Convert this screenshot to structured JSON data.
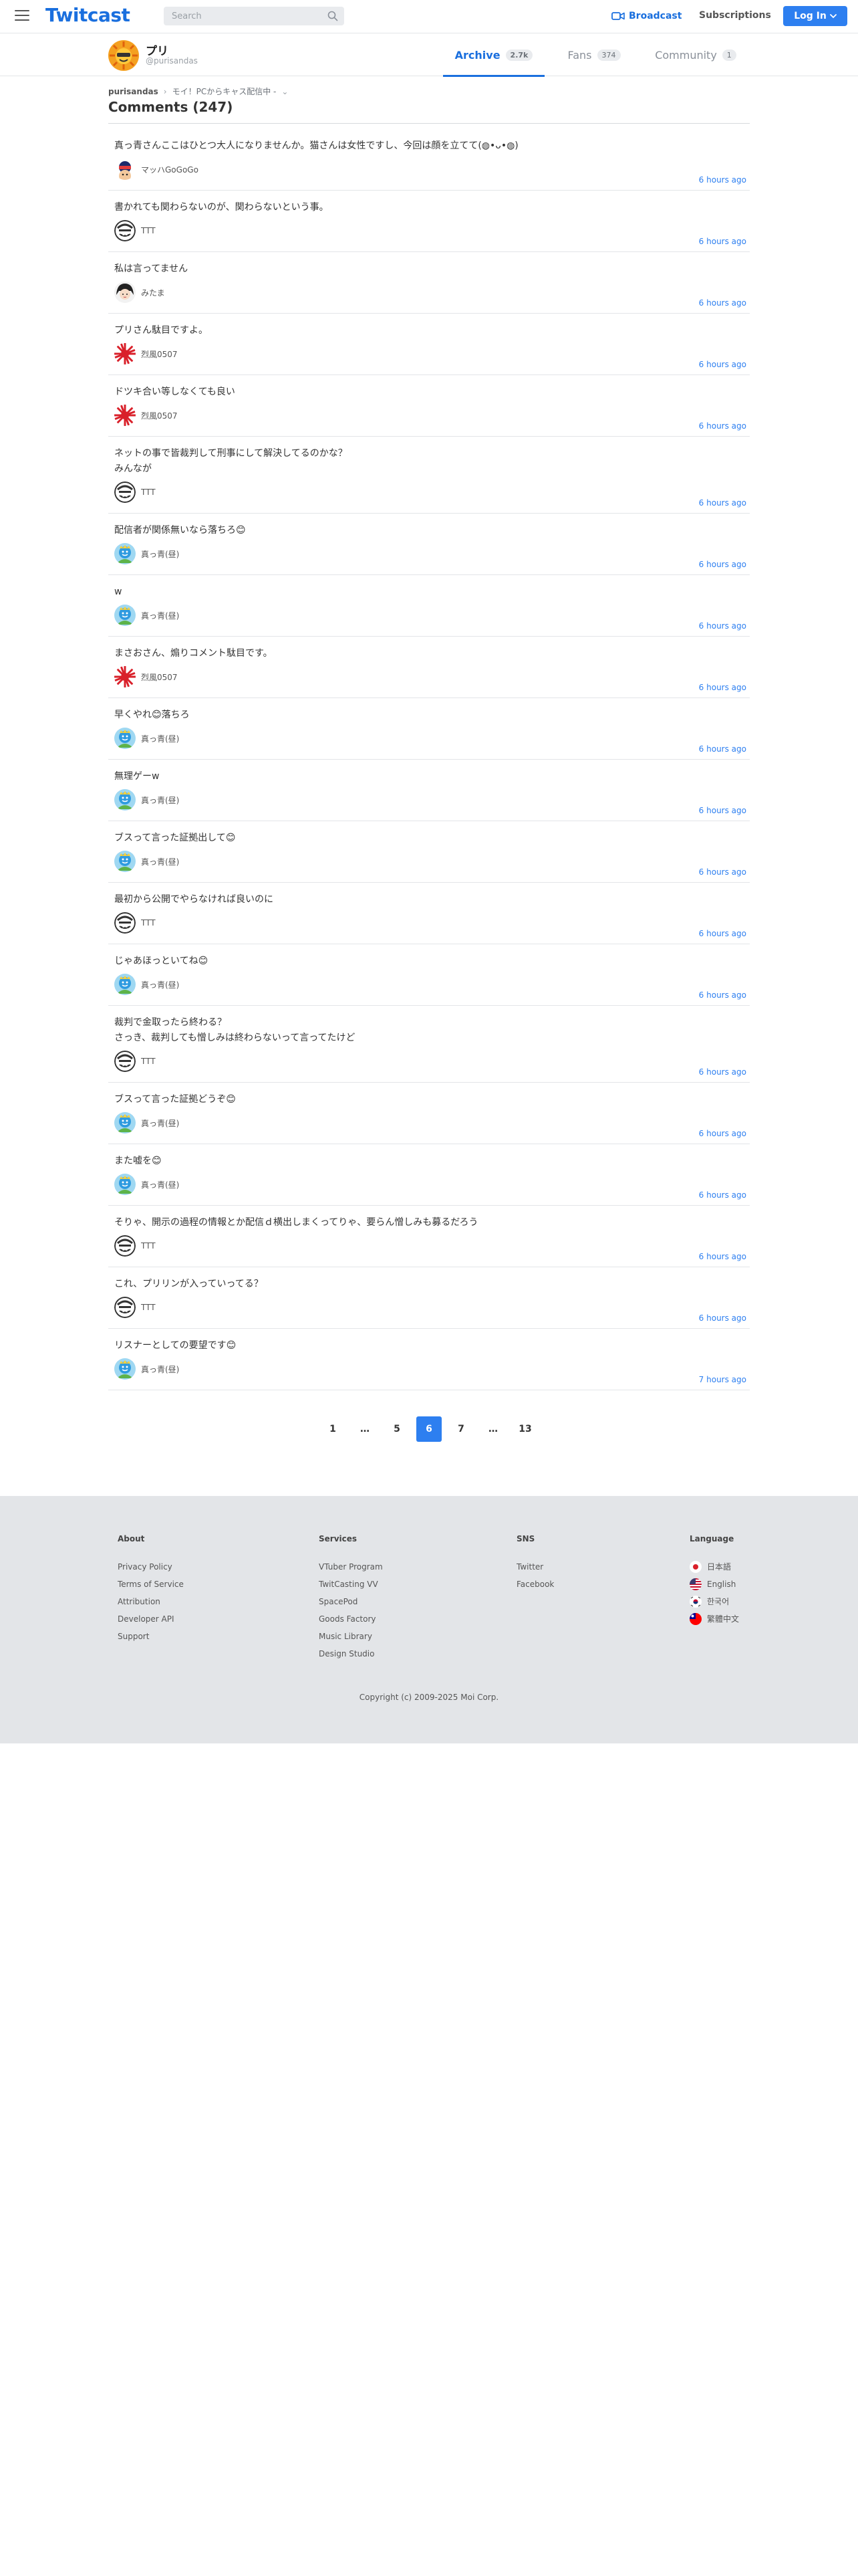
{
  "header": {
    "logo": "Twitcast",
    "search_placeholder": "Search",
    "broadcast_label": "Broadcast",
    "subscriptions_label": "Subscriptions",
    "login_label": "Log In"
  },
  "user": {
    "name": "プリ",
    "handle": "@purisandas"
  },
  "tabs": [
    {
      "label": "Archive",
      "count": "2.7k"
    },
    {
      "label": "Fans",
      "count": "374"
    },
    {
      "label": "Community",
      "count": "1"
    }
  ],
  "breadcrumb": {
    "user": "purisandas",
    "movie": "モイ！PCからキャス配信中 -"
  },
  "page_title": "Comments (247)",
  "comments": [
    {
      "text": "真っ青さんここはひとつ大人になりませんか。猫さんは女性ですし、今回は顔を立てて(◍•ᴗ•◍)",
      "user": "マッハGoGoGo",
      "time": "6 hours ago",
      "avatar": "mach"
    },
    {
      "text": "書かれても関わらないのが、関わらないという事。",
      "user": "TTT",
      "time": "6 hours ago",
      "avatar": "ttt"
    },
    {
      "text": "私は言ってません",
      "user": "みたま",
      "time": "6 hours ago",
      "avatar": "mitama"
    },
    {
      "text": "プリさん駄目ですよ。",
      "user": "烈風0507",
      "time": "6 hours ago",
      "avatar": "reppu"
    },
    {
      "text": "ドツキ合い等しなくても良い",
      "user": "烈風0507",
      "time": "6 hours ago",
      "avatar": "reppu"
    },
    {
      "text": "ネットの事で皆裁判して刑事にして解決してるのかな？\nみんなが",
      "user": "TTT",
      "time": "6 hours ago",
      "avatar": "ttt"
    },
    {
      "text": "配信者が関係無いなら落ちろ😊",
      "user": "真っ青(昼)",
      "time": "6 hours ago",
      "avatar": "massao"
    },
    {
      "text": "w",
      "user": "真っ青(昼)",
      "time": "6 hours ago",
      "avatar": "massao"
    },
    {
      "text": "まさおさん、煽りコメント駄目です。",
      "user": "烈風0507",
      "time": "6 hours ago",
      "avatar": "reppu"
    },
    {
      "text": "早くやれ😊落ちろ",
      "user": "真っ青(昼)",
      "time": "6 hours ago",
      "avatar": "massao"
    },
    {
      "text": "無理ゲーw",
      "user": "真っ青(昼)",
      "time": "6 hours ago",
      "avatar": "massao"
    },
    {
      "text": "ブスって言った証拠出して😊",
      "user": "真っ青(昼)",
      "time": "6 hours ago",
      "avatar": "massao"
    },
    {
      "text": "最初から公開でやらなければ良いのに",
      "user": "TTT",
      "time": "6 hours ago",
      "avatar": "ttt"
    },
    {
      "text": "じゃあほっといてね😊",
      "user": "真っ青(昼)",
      "time": "6 hours ago",
      "avatar": "massao"
    },
    {
      "text": "裁判で金取ったら終わる？\nさっき、裁判しても憎しみは終わらないって言ってたけど",
      "user": "TTT",
      "time": "6 hours ago",
      "avatar": "ttt"
    },
    {
      "text": "ブスって言った証拠どうぞ😊",
      "user": "真っ青(昼)",
      "time": "6 hours ago",
      "avatar": "massao"
    },
    {
      "text": "また嘘を😊",
      "user": "真っ青(昼)",
      "time": "6 hours ago",
      "avatar": "massao"
    },
    {
      "text": "そりゃ、開示の過程の情報とか配信ｄ横出しまくってりゃ、要らん憎しみも募るだろう",
      "user": "TTT",
      "time": "6 hours ago",
      "avatar": "ttt"
    },
    {
      "text": "これ、プリリンが入っていってる？",
      "user": "TTT",
      "time": "6 hours ago",
      "avatar": "ttt"
    },
    {
      "text": "リスナーとしての要望です😊",
      "user": "真っ青(昼)",
      "time": "7 hours ago",
      "avatar": "massao"
    }
  ],
  "pagination": [
    "1",
    "…",
    "5",
    "6",
    "7",
    "…",
    "13"
  ],
  "pagination_current": "6",
  "footer": {
    "about": {
      "title": "About",
      "links": [
        "Privacy Policy",
        "Terms of Service",
        "Attribution",
        "Developer API",
        "Support"
      ]
    },
    "services": {
      "title": "Services",
      "links": [
        "VTuber Program",
        "TwitCasting VV",
        "SpacePod",
        "Goods Factory",
        "Music Library",
        "Design Studio"
      ]
    },
    "sns": {
      "title": "SNS",
      "links": [
        "Twitter",
        "Facebook"
      ]
    },
    "language": {
      "title": "Language",
      "links": [
        "日本語",
        "English",
        "한국어",
        "繁體中文"
      ]
    },
    "copyright": "Copyright (c) 2009-2025 Moi Corp."
  },
  "colors": {
    "accent": "#2d7ff0",
    "brand": "#1a6fde",
    "footer_bg": "#e3e5e8"
  }
}
